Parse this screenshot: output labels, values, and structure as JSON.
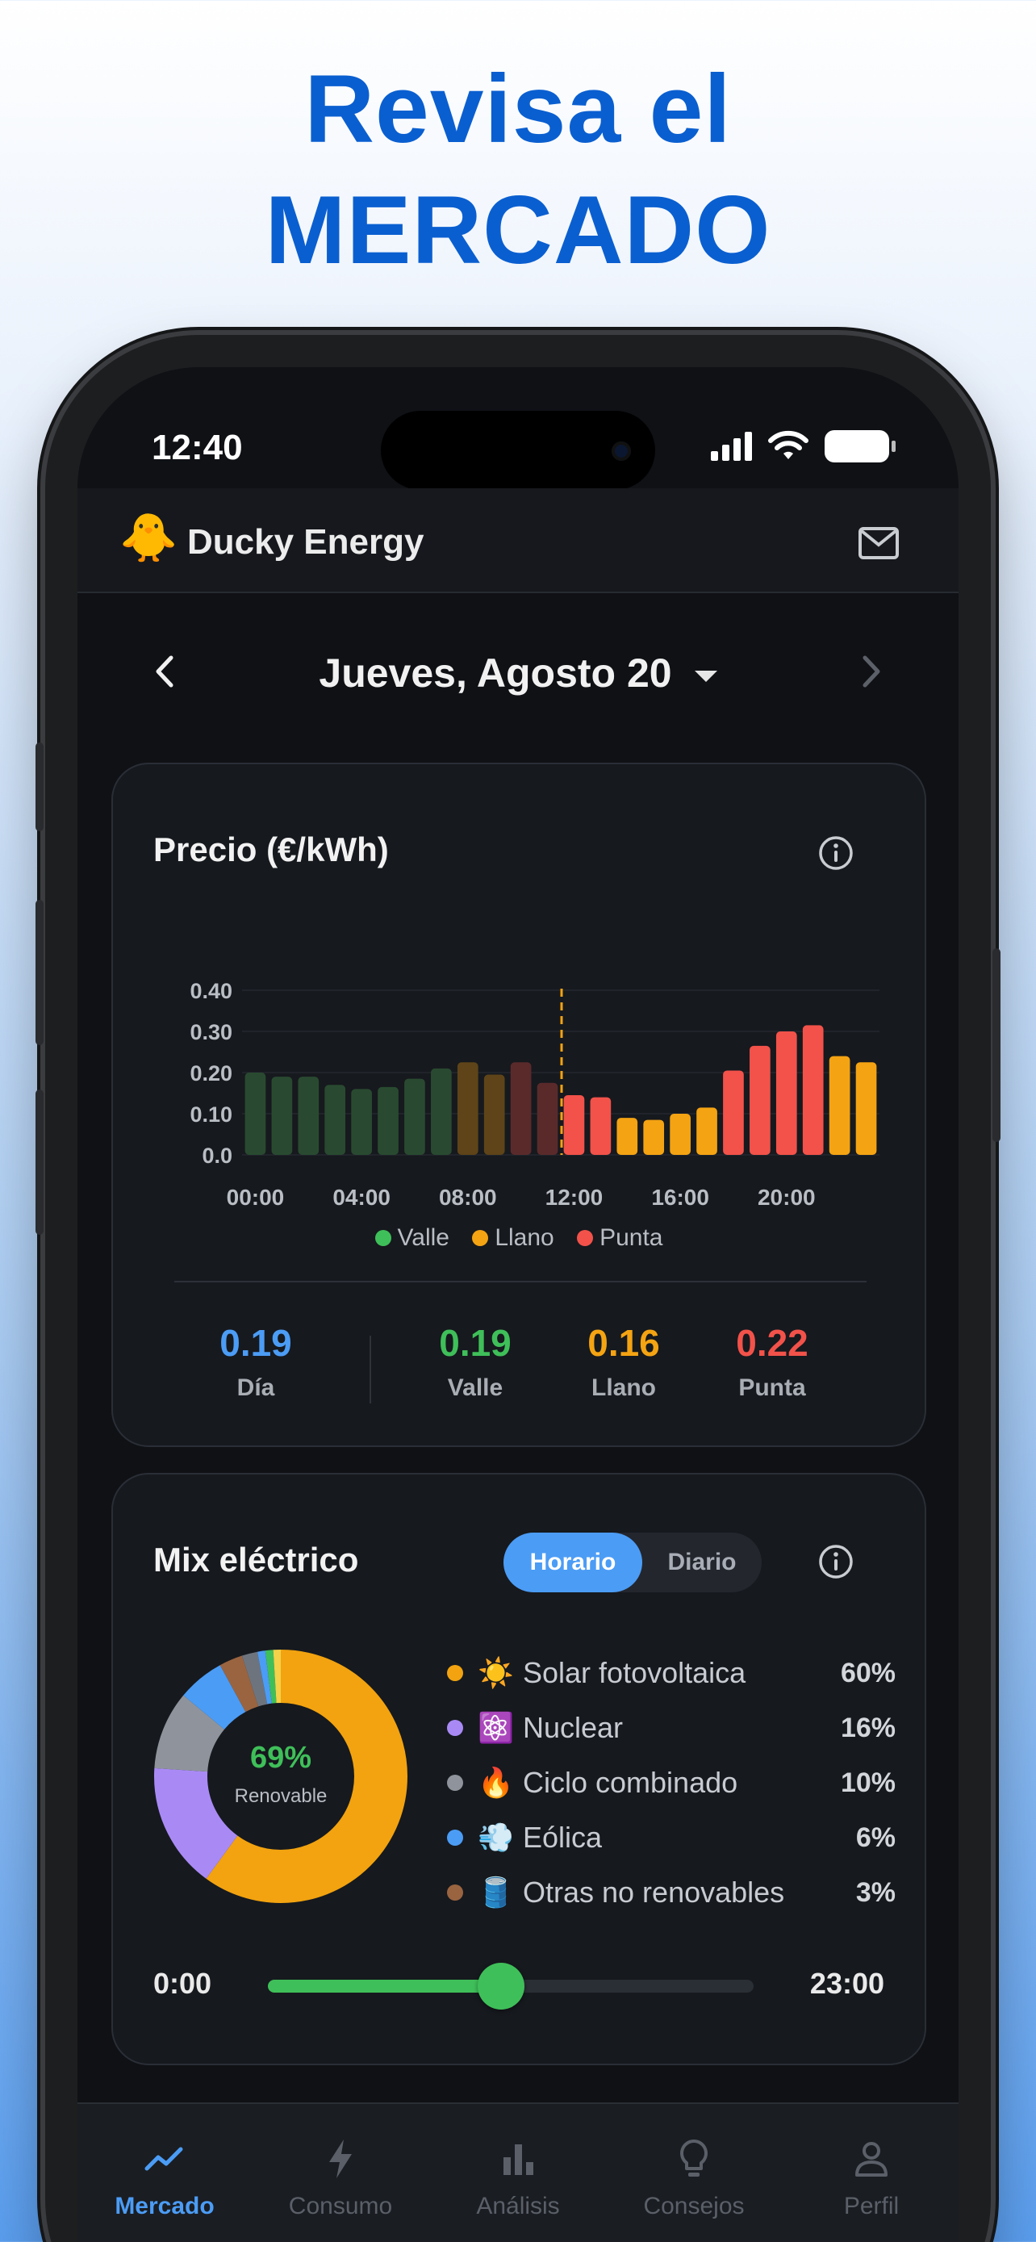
{
  "headline": {
    "line1": "Revisa el",
    "line2": "MERCADO"
  },
  "status_bar": {
    "time": "12:40"
  },
  "app": {
    "logo": "🐥",
    "title": "Ducky Energy"
  },
  "date_nav": {
    "title": "Jueves, Agosto 20"
  },
  "price_card": {
    "title": "Precio (€/kWh)",
    "stats": [
      {
        "value": "0.19",
        "label": "Día",
        "color": "#4b9cf5"
      },
      {
        "value": "0.19",
        "label": "Valle",
        "color": "#3fbf59"
      },
      {
        "value": "0.16",
        "label": "Llano",
        "color": "#f4a312"
      },
      {
        "value": "0.22",
        "label": "Punta",
        "color": "#f2524a"
      }
    ]
  },
  "chart_data": {
    "type": "bar",
    "categories": [
      "00:00",
      "01:00",
      "02:00",
      "03:00",
      "04:00",
      "05:00",
      "06:00",
      "07:00",
      "08:00",
      "09:00",
      "10:00",
      "11:00",
      "12:00",
      "13:00",
      "14:00",
      "15:00",
      "16:00",
      "17:00",
      "18:00",
      "19:00",
      "20:00",
      "21:00",
      "22:00",
      "23:00"
    ],
    "values": [
      0.2,
      0.19,
      0.19,
      0.17,
      0.16,
      0.165,
      0.185,
      0.21,
      0.225,
      0.195,
      0.225,
      0.175,
      0.145,
      0.14,
      0.09,
      0.085,
      0.1,
      0.115,
      0.205,
      0.265,
      0.3,
      0.315,
      0.24,
      0.225
    ],
    "tariff": [
      "valle",
      "valle",
      "valle",
      "valle",
      "valle",
      "valle",
      "valle",
      "valle",
      "llano",
      "llano",
      "punta",
      "punta",
      "punta",
      "punta",
      "llano",
      "llano",
      "llano",
      "llano",
      "punta",
      "punta",
      "punta",
      "punta",
      "llano",
      "llano"
    ],
    "faded_before_index": 12,
    "current_hour_index": 12,
    "yticks": [
      "0.0",
      "0.10",
      "0.20",
      "0.30",
      "0.40"
    ],
    "ylim": [
      0,
      0.4
    ],
    "xtick_labels": [
      "00:00",
      "04:00",
      "08:00",
      "12:00",
      "16:00",
      "20:00"
    ],
    "legend": [
      {
        "name": "Valle",
        "color": "#3fbf59"
      },
      {
        "name": "Llano",
        "color": "#f4a312"
      },
      {
        "name": "Punta",
        "color": "#f2524a"
      }
    ],
    "colors": {
      "valle": "#3fbf59",
      "llano": "#f4a312",
      "punta": "#f2524a",
      "valle_faded": "#294a30",
      "llano_faded": "#5e4418",
      "punta_faded": "#5a2a2b",
      "marker": "#f4a312"
    },
    "xlabel": "",
    "ylabel": ""
  },
  "mix_card": {
    "title": "Mix eléctrico",
    "toggle_on": "Horario",
    "toggle_off": "Diario",
    "renewable_pct": "69%",
    "renewable_label": "Renovable",
    "items": [
      {
        "emoji": "☀️",
        "name": "Solar fotovoltaica",
        "pct": "60%",
        "color": "#f2a30f"
      },
      {
        "emoji": "⚛️",
        "name": "Nuclear",
        "pct": "16%",
        "color": "#a98af5"
      },
      {
        "emoji": "🔥",
        "name": "Ciclo combinado",
        "pct": "10%",
        "color": "#8f949c"
      },
      {
        "emoji": "💨",
        "name": "Eólica",
        "pct": "6%",
        "color": "#4b9cf5"
      },
      {
        "emoji": "🛢️",
        "name": "Otras no renovables",
        "pct": "3%",
        "color": "#9a6440"
      }
    ],
    "donut_extra": [
      {
        "value": 2,
        "color": "#6e747d"
      },
      {
        "value": 1,
        "color": "#4b9cf5"
      },
      {
        "value": 1,
        "color": "#3fbf59"
      },
      {
        "value": 1,
        "color": "#f4d24a"
      }
    ],
    "slider": {
      "start": "0:00",
      "end": "23:00",
      "value_fraction": 0.48
    }
  },
  "tabbar": {
    "tabs": [
      {
        "label": "Mercado",
        "icon": "trend-icon",
        "active": true
      },
      {
        "label": "Consumo",
        "icon": "bolt-icon",
        "active": false
      },
      {
        "label": "Análisis",
        "icon": "bar-chart-icon",
        "active": false
      },
      {
        "label": "Consejos",
        "icon": "lightbulb-icon",
        "active": false
      },
      {
        "label": "Perfil",
        "icon": "person-icon",
        "active": false
      }
    ]
  }
}
